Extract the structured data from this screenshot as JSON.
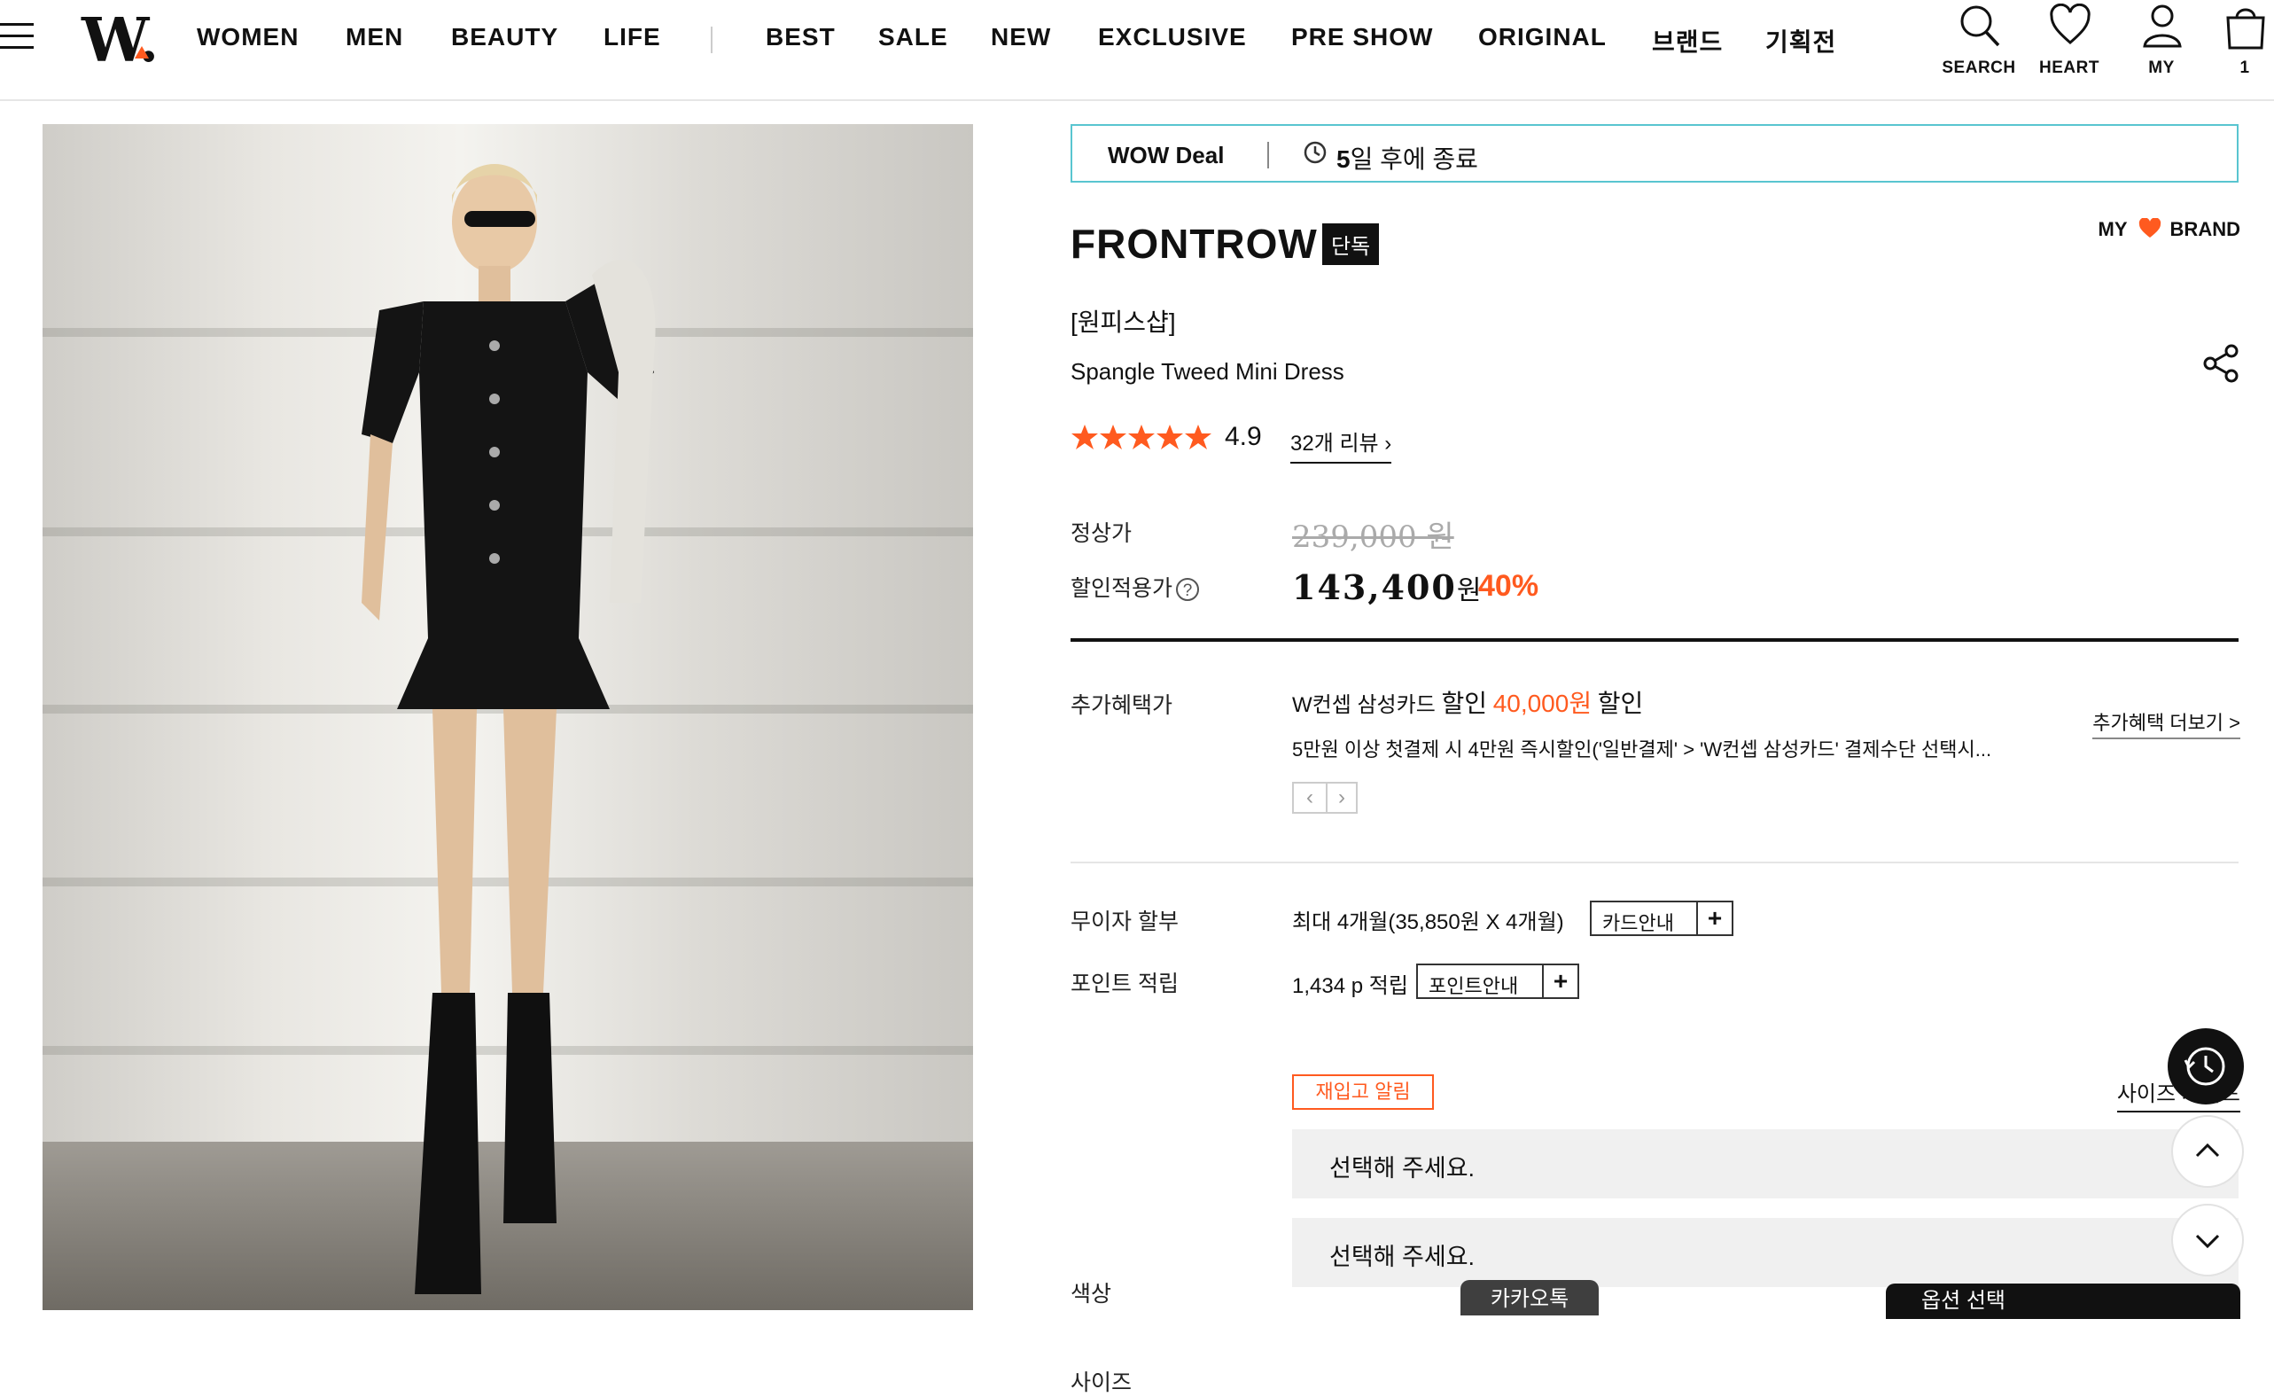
{
  "header": {
    "logo": "W.",
    "nav": [
      "WOMEN",
      "MEN",
      "BEAUTY",
      "LIFE",
      "BEST",
      "SALE",
      "NEW",
      "EXCLUSIVE",
      "PRE SHOW",
      "ORIGINAL",
      "브랜드",
      "기획전"
    ],
    "icons": {
      "search_label": "SEARCH",
      "heart_label": "HEART",
      "my_label": "MY",
      "cart_count": "1"
    }
  },
  "product": {
    "deal": {
      "label": "WOW Deal",
      "days": "5",
      "time_suffix": "일 후에 종료"
    },
    "brand": "FRONTROW",
    "exclusive_badge": "단독",
    "my_brand": {
      "my": "MY",
      "brand": "BRAND"
    },
    "category": "[원피스샵]",
    "name": "Spangle Tweed Mini Dress",
    "rating": "4.9",
    "reviews": "32개 리뷰",
    "price": {
      "regular_label": "정상가",
      "regular": "239,000 원",
      "sale_label": "할인적용가",
      "help": "?",
      "sale": "143,400",
      "won": "원",
      "discount": "40%"
    },
    "benefit": {
      "label": "추가혜택가",
      "prefix": "W컨셉 삼성카드",
      "word_discount": "할인",
      "amount": "40,000원",
      "suffix": "할인",
      "detail": "5만원 이상 첫결제 시 4만원 즉시할인('일반결제' > 'W컨셉 삼성카드' 결제수단 선택시...",
      "more": "추가혜택 더보기 >",
      "prev": "‹",
      "next": "›"
    },
    "installment": {
      "label": "무이자 할부",
      "value": "최대 4개월(35,850원 X 4개월)",
      "button": "카드안내",
      "plus": "+"
    },
    "points": {
      "label": "포인트 적립",
      "value": "1,434 p 적립",
      "button": "포인트안내",
      "plus": "+"
    },
    "restock": "재입고 알림",
    "size_guide": "사이즈 가이드",
    "color": {
      "label": "색상",
      "placeholder": "선택해 주세요."
    },
    "size": {
      "label": "사이즈",
      "placeholder": "선택해 주세요."
    }
  },
  "bottom": {
    "kakao": "카카오톡",
    "buy": "옵션 선택"
  },
  "colors": {
    "accent": "#ff5a1f",
    "deal_border": "#59c5d0",
    "dark": "#111111"
  }
}
